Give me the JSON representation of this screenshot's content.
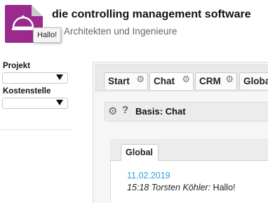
{
  "header": {
    "title": "die controlling management software",
    "subtitle": "Architekten und Ingenieure",
    "tooltip": "Hallo!",
    "brand_color": "#9b2a8c",
    "logo_icon": "service-bell-icon"
  },
  "filters": {
    "projekt_label": "Projekt",
    "projekt_value": "",
    "kostenstelle_label": "Kostenstelle",
    "kostenstelle_value": ""
  },
  "tabs": [
    {
      "label": "Start",
      "icon": "gear-icon"
    },
    {
      "label": "Chat",
      "icon": "gear-icon",
      "active": true
    },
    {
      "label": "CRM",
      "icon": "gear-icon"
    },
    {
      "label": "Globa",
      "icon": "gear-icon"
    }
  ],
  "section": {
    "title": "Basis: Chat",
    "icons": [
      "gear-icon",
      "help-icon"
    ]
  },
  "chat": {
    "tab_label": "Global",
    "messages": [
      {
        "date": "11.02.2019",
        "meta": "15:18 Torsten Köhler:",
        "text": "Hallo!"
      }
    ],
    "date_color": "#2aa3d8"
  }
}
